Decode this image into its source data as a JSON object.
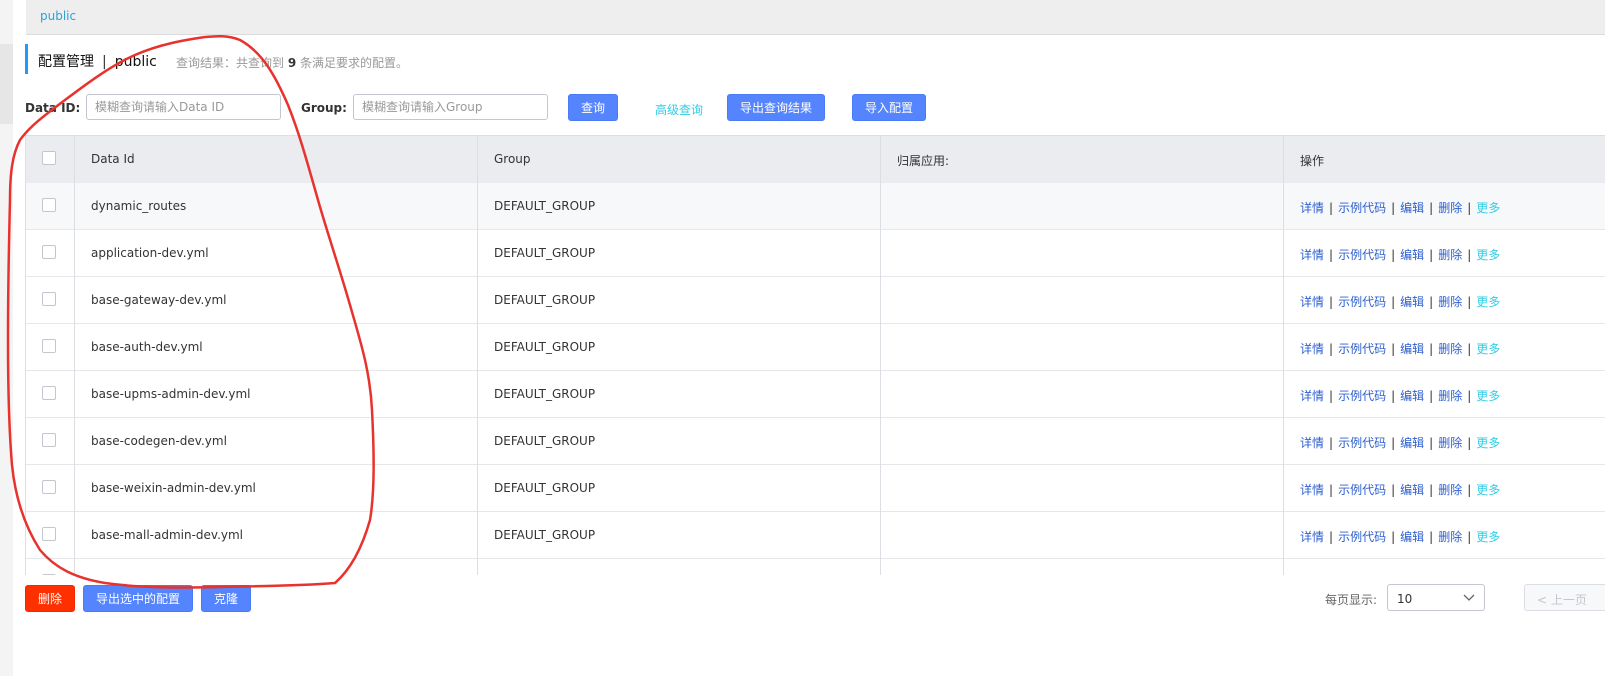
{
  "namespace_tab": "public",
  "header": {
    "title": "配置管理",
    "namespace": "public",
    "summary_prefix": "查询结果：共查询到",
    "summary_count": "9",
    "summary_suffix": "条满足要求的配置。"
  },
  "search": {
    "data_id_label": "Data ID:",
    "data_id_placeholder": "模糊查询请输入Data ID",
    "group_label": "Group:",
    "group_placeholder": "模糊查询请输入Group",
    "query_button": "查询",
    "advanced_query": "高级查询",
    "export_results": "导出查询结果",
    "import_config": "导入配置"
  },
  "table": {
    "columns": [
      "Data Id",
      "Group",
      "归属应用:",
      "操作"
    ],
    "rows": [
      {
        "data_id": "dynamic_routes",
        "group": "DEFAULT_GROUP",
        "app": ""
      },
      {
        "data_id": "application-dev.yml",
        "group": "DEFAULT_GROUP",
        "app": ""
      },
      {
        "data_id": "base-gateway-dev.yml",
        "group": "DEFAULT_GROUP",
        "app": ""
      },
      {
        "data_id": "base-auth-dev.yml",
        "group": "DEFAULT_GROUP",
        "app": ""
      },
      {
        "data_id": "base-upms-admin-dev.yml",
        "group": "DEFAULT_GROUP",
        "app": ""
      },
      {
        "data_id": "base-codegen-dev.yml",
        "group": "DEFAULT_GROUP",
        "app": ""
      },
      {
        "data_id": "base-weixin-admin-dev.yml",
        "group": "DEFAULT_GROUP",
        "app": ""
      },
      {
        "data_id": "base-mall-admin-dev.yml",
        "group": "DEFAULT_GROUP",
        "app": ""
      }
    ],
    "actions": {
      "detail": "详情",
      "sample_code": "示例代码",
      "edit": "编辑",
      "delete": "删除",
      "more": "更多",
      "separator": "|"
    }
  },
  "footer": {
    "delete_button": "删除",
    "export_selected_button": "导出选中的配置",
    "clone_button": "克隆",
    "page_size_label": "每页显示:",
    "page_size_value": "10",
    "prev_page": "< 上一页"
  },
  "colors": {
    "primary": "#5584ff",
    "danger": "#ff3000",
    "link": "#2f60cf",
    "link_light": "#33cde5",
    "annotation": "#e8322d"
  }
}
